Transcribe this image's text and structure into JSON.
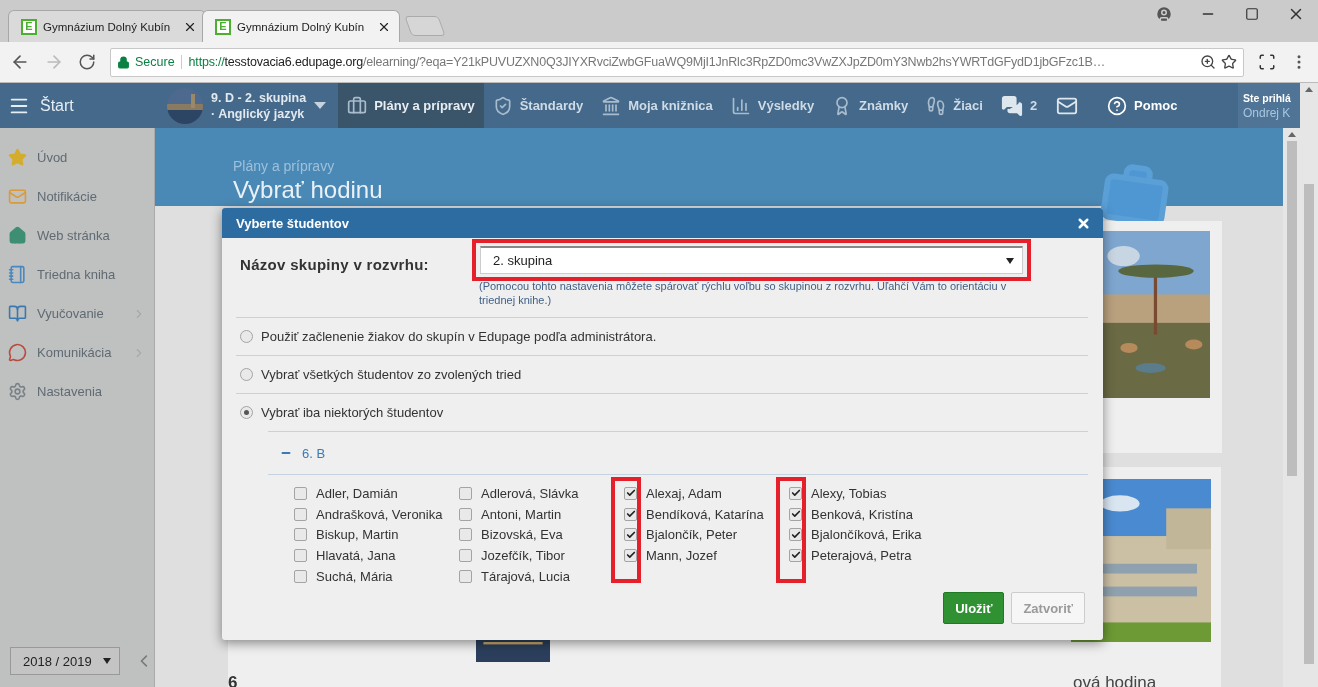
{
  "browser": {
    "tabs": [
      {
        "favicon_letter": "E",
        "title": "Gymnázium Dolný Kubín",
        "selected": false
      },
      {
        "favicon_letter": "E",
        "title": "Gymnázium Dolný Kubín",
        "selected": true
      }
    ],
    "secure_label": "Secure",
    "url_scheme": "https://",
    "url_host": "tesstovacia6.edupage.org",
    "url_path": "/elearning/?eqa=Y21kPUVUZXN0Q3JIYXRvciZwbGFuaWQ9MjI1JnRlc3RpZD0mc3VwZXJpZD0mY3Nwb2hsYWRTdGFydD1jbGFzc1B…"
  },
  "nav": {
    "start": "Štart",
    "course_line1": "9. D - 2. skupina",
    "course_line2": "· Anglický jazyk",
    "items": [
      {
        "label": "Plány a prípravy",
        "selected": true
      },
      {
        "label": "Štandardy",
        "selected": false
      },
      {
        "label": "Moja knižnica",
        "selected": false
      },
      {
        "label": "Výsledky",
        "selected": false
      },
      {
        "label": "Známky",
        "selected": false
      },
      {
        "label": "Žiaci",
        "selected": false
      }
    ],
    "messages_count": "2",
    "help": "Pomoc",
    "user_line1": "Ste prihlá",
    "user_line2": "Ondrej K"
  },
  "sidebar": {
    "items": [
      {
        "label": "Úvod",
        "has_submenu": false
      },
      {
        "label": "Notifikácie",
        "has_submenu": false
      },
      {
        "label": "Web stránka",
        "has_submenu": false
      },
      {
        "label": "Triedna kniha",
        "has_submenu": false
      },
      {
        "label": "Vyučovanie",
        "has_submenu": true
      },
      {
        "label": "Komunikácia",
        "has_submenu": true
      },
      {
        "label": "Nastavenia",
        "has_submenu": false
      }
    ],
    "school_year": "2018 / 2019"
  },
  "page": {
    "subtitle": "Plány a prípravy",
    "title": "Vybrať hodinu",
    "card_number": "6",
    "card_title": "ová hodina"
  },
  "modal": {
    "title": "Vyberte študentov",
    "group_label": "Názov skupiny v rozvrhu:",
    "group_value": "2. skupina",
    "group_highlight": true,
    "hint": "(Pomocou tohto nastavenia môžete spárovať rýchlu voľbu so skupinou z rozvrhu. Uľahčí Vám to orientáciu v triednej knihe.)",
    "options": [
      {
        "label": "Použiť začlenenie žiakov do skupín v Edupage podľa administrátora.",
        "selected": false
      },
      {
        "label": "Vybrať všetkých študentov zo zvolených tried",
        "selected": false
      },
      {
        "label": "Vybrať iba niektorých študentov",
        "selected": true
      }
    ],
    "class_name": "6. B",
    "class_expanded": true,
    "columns": [
      {
        "highlight": false,
        "students": [
          {
            "name": "Adler, Damián",
            "checked": false
          },
          {
            "name": "Andrašková, Veronika",
            "checked": false
          },
          {
            "name": "Biskup, Martin",
            "checked": false
          },
          {
            "name": "Hlavatá, Jana",
            "checked": false
          },
          {
            "name": "Suchá, Mária",
            "checked": false
          }
        ]
      },
      {
        "highlight": false,
        "students": [
          {
            "name": "Adlerová, Slávka",
            "checked": false
          },
          {
            "name": "Antoni, Martin",
            "checked": false
          },
          {
            "name": "Bizovská, Eva",
            "checked": false
          },
          {
            "name": "Jozefčík, Tibor",
            "checked": false
          },
          {
            "name": "Tárajová, Lucia",
            "checked": false
          }
        ]
      },
      {
        "highlight": true,
        "students": [
          {
            "name": "Alexaj, Adam",
            "checked": true
          },
          {
            "name": "Bendíková, Katarína",
            "checked": true
          },
          {
            "name": "Bjalončík, Peter",
            "checked": true
          },
          {
            "name": "Mann, Jozef",
            "checked": true
          }
        ]
      },
      {
        "highlight": true,
        "students": [
          {
            "name": "Alexy, Tobias",
            "checked": true
          },
          {
            "name": "Benková, Kristína",
            "checked": true
          },
          {
            "name": "Bjalončíková, Erika",
            "checked": true
          },
          {
            "name": "Peterajová, Petra",
            "checked": true
          }
        ]
      }
    ],
    "save_button": "Uložiť",
    "close_button": "Zatvoriť"
  }
}
